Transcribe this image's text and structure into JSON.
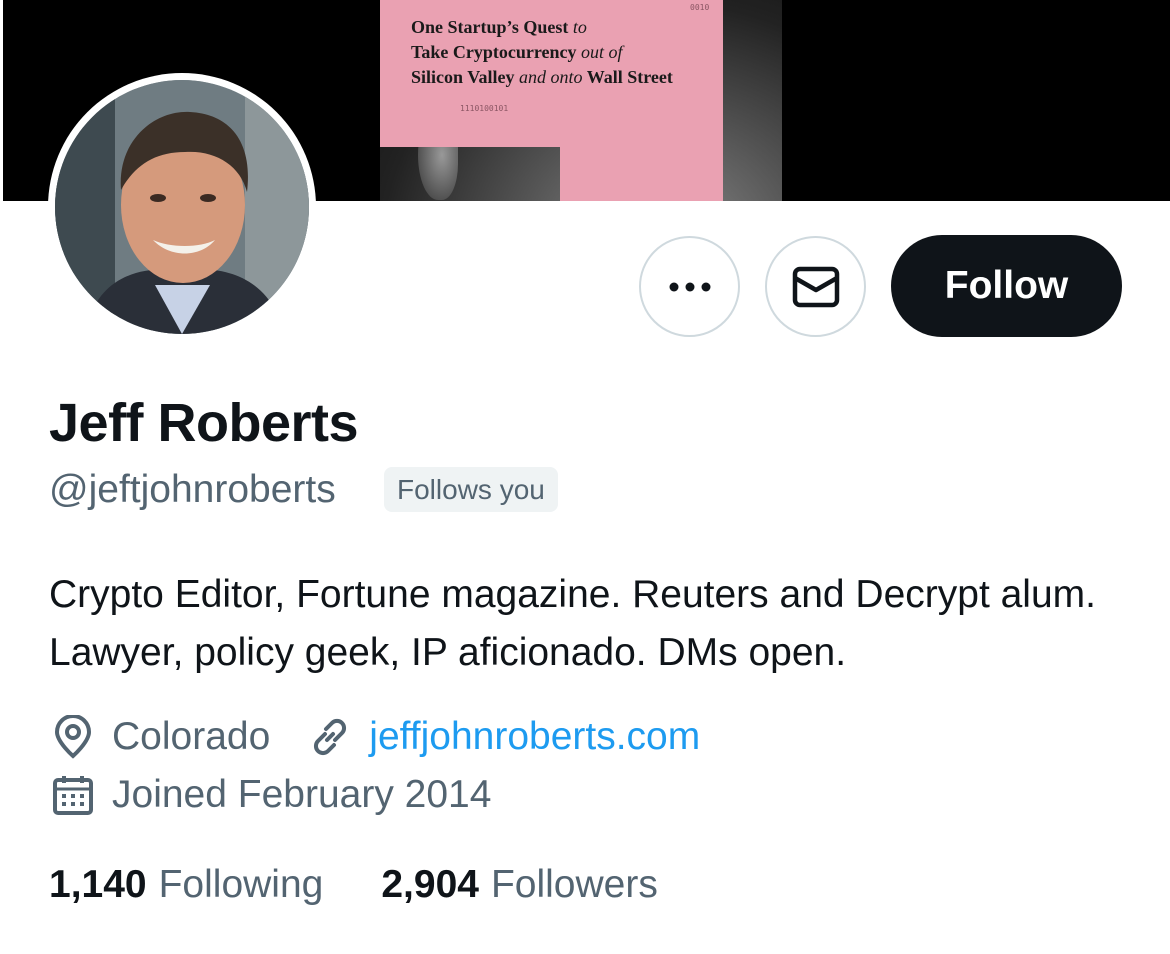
{
  "banner": {
    "book_lines": [
      {
        "a": "One Startup’s Quest ",
        "b": "to"
      },
      {
        "a": "Take Cryptocurrency ",
        "b": "out of"
      },
      {
        "a": "Silicon Valley ",
        "b": "and onto",
        "c": " Wall Street"
      }
    ],
    "bits_top": "0010",
    "bits_bottom": "1110100101"
  },
  "actions": {
    "more_icon": "more-horizontal-icon",
    "message_icon": "envelope-icon",
    "follow_label": "Follow"
  },
  "profile": {
    "name": "Jeff Roberts",
    "handle": "@jeftjohnroberts",
    "follows_you": "Follows you",
    "bio": "Crypto Editor, Fortune magazine. Reuters and Decrypt alum. Lawyer, policy geek, IP aficionado. DMs open.",
    "location": "Colorado",
    "website": "jeffjohnroberts.com",
    "joined": "Joined February 2014"
  },
  "stats": {
    "following_count": "1,140",
    "following_label": "Following",
    "followers_count": "2,904",
    "followers_label": "Followers"
  },
  "colors": {
    "accent_link": "#1d9bf0",
    "follow_bg": "#0f1419",
    "secondary_text": "#536471"
  }
}
